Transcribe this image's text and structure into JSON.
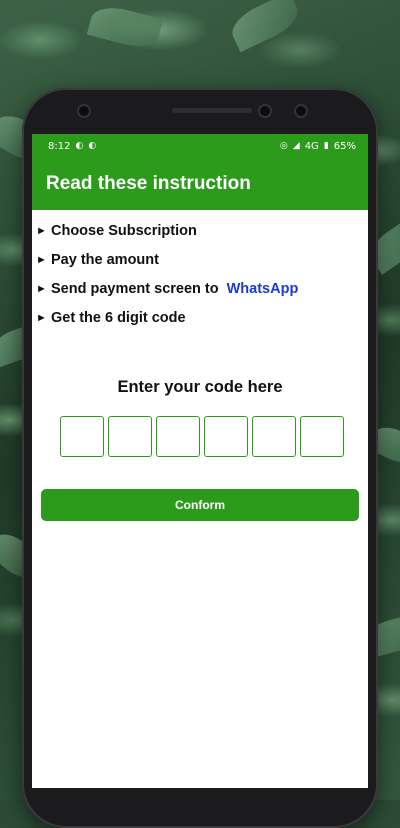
{
  "status_bar": {
    "time": "8:12",
    "left_icons": [
      "notification-icon",
      "notification-icon"
    ],
    "right_icons": [
      "hotspot-icon",
      "signal-icon",
      "battery-icon"
    ],
    "network": "4G",
    "battery": "65%"
  },
  "app_bar": {
    "title": "Read these instruction"
  },
  "steps": [
    {
      "text": "Choose Subscription"
    },
    {
      "text": "Pay the amount"
    },
    {
      "text": "Send payment screen to",
      "link": "WhatsApp"
    },
    {
      "text": "Get the 6 digit code"
    }
  ],
  "code": {
    "title": "Enter your code here",
    "digits": [
      "",
      "",
      "",
      "",
      "",
      ""
    ]
  },
  "confirm_button": {
    "label": "Conform"
  },
  "colors": {
    "primary": "#2c9b1c",
    "link": "#1a3bd6"
  }
}
